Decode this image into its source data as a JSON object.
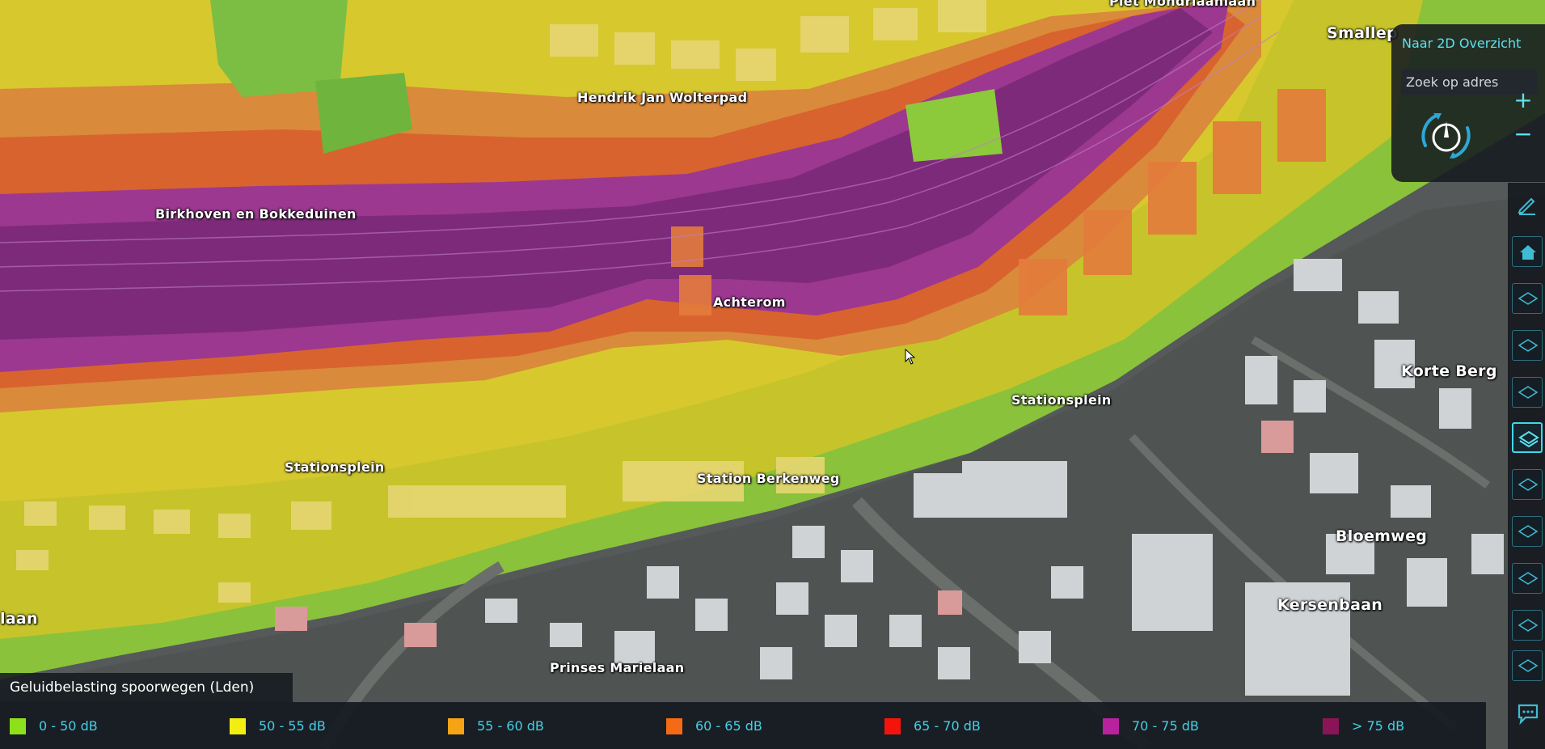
{
  "map": {
    "streets": [
      "Piet Mondriaanlaan",
      "Smallep",
      "Hendrik Jan Wolterpad",
      "Birkhoven en Bokkeduinen",
      "Achterom",
      "Stationsplein",
      "Stationsplein",
      "Station Berkenweg",
      "Korte Berg",
      "Bloemweg",
      "Kersenbaan",
      "laan",
      "Prinses Marielaan"
    ]
  },
  "controls": {
    "overview_2d": "Naar 2D Overzicht",
    "address_placeholder": "Zoek op adres",
    "zoom_in": "+",
    "zoom_out": "−"
  },
  "toolbar": {
    "icons": [
      "pencil-icon",
      "home-icon",
      "layer-icon",
      "layer-icon",
      "layer-icon",
      "layer-icon",
      "layer-icon",
      "layer-icon",
      "layer-icon",
      "layer-icon",
      "layer-icon",
      "chat-icon"
    ],
    "active_index": 6
  },
  "legend": {
    "title": "Geluidbelasting spoorwegen (Lden)",
    "items": [
      {
        "label": "0 - 50 dB",
        "color": "#8ee01a"
      },
      {
        "label": "50 - 55 dB",
        "color": "#f2ee12"
      },
      {
        "label": "55 - 60 dB",
        "color": "#f5a414"
      },
      {
        "label": "60 - 65 dB",
        "color": "#f56a14"
      },
      {
        "label": "65 - 70 dB",
        "color": "#f5140c"
      },
      {
        "label": "70 - 75 dB",
        "color": "#b8229e"
      },
      {
        "label": "> 75 dB",
        "color": "#8a1458"
      }
    ]
  }
}
